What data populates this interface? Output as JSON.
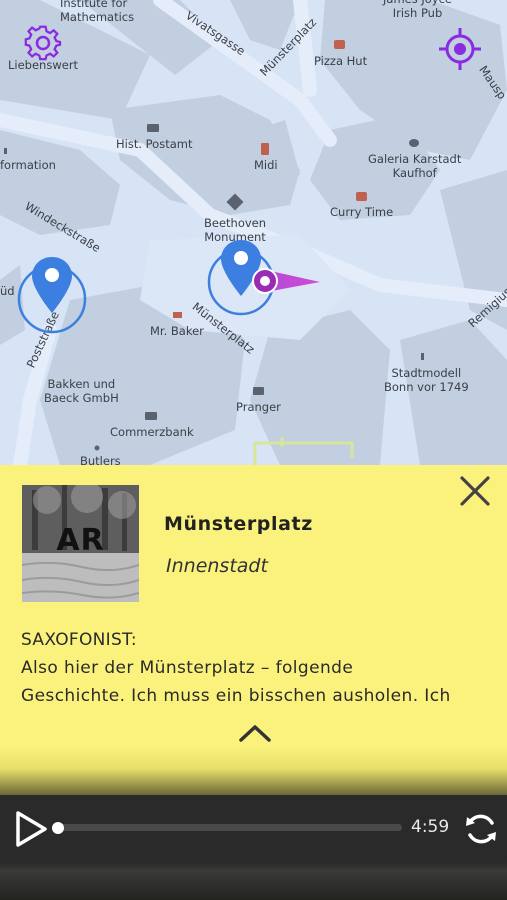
{
  "map": {
    "labels": {
      "institute": "Institute for\nMathematics",
      "liebenswert": "Liebenswert",
      "vivatsgasse": "Vivatsgasse",
      "muensterplatz_street_top": "Münsterplatz",
      "irish_pub": "James Joyce\nIrish Pub",
      "pizza_hut": "Pizza Hut",
      "mausp": "Mausp",
      "hist_postamt": "Hist. Postamt",
      "midi": "Midi",
      "galeria": "Galeria Karstadt\nKaufhof",
      "information": "formation",
      "windeckstrasse": "Windeckstraße",
      "beethoven": "Beethoven\nMonument",
      "curry_time": "Curry Time",
      "remigius": "Remigiuss",
      "sued": "üd",
      "muensterplatz_street_bottom": "Münsterplatz",
      "mr_baker": "Mr. Baker",
      "poststrasse": "Poststraße",
      "stadtmodell": "Stadtmodell\nBonn vor 1749",
      "bakken": "Bakken und\nBaeck GmbH",
      "pranger": "Pranger",
      "commerzbank": "Commerzbank",
      "butlers": "Butlers"
    },
    "icons": {
      "settings": "gear-icon",
      "locate": "crosshair-icon"
    },
    "accent": "#8a2be2"
  },
  "sheet": {
    "thumb_overlay": "AR",
    "title": "Münsterplatz",
    "subtitle": "Innenstadt",
    "speaker": "SAXOFONIST:",
    "line1": "Also hier der Münsterplatz – folgende",
    "line2": "Geschichte. Ich muss ein bisschen ausholen. Ich",
    "background": "#fbf27e"
  },
  "player": {
    "time": "4:59",
    "progress": 0.0
  }
}
